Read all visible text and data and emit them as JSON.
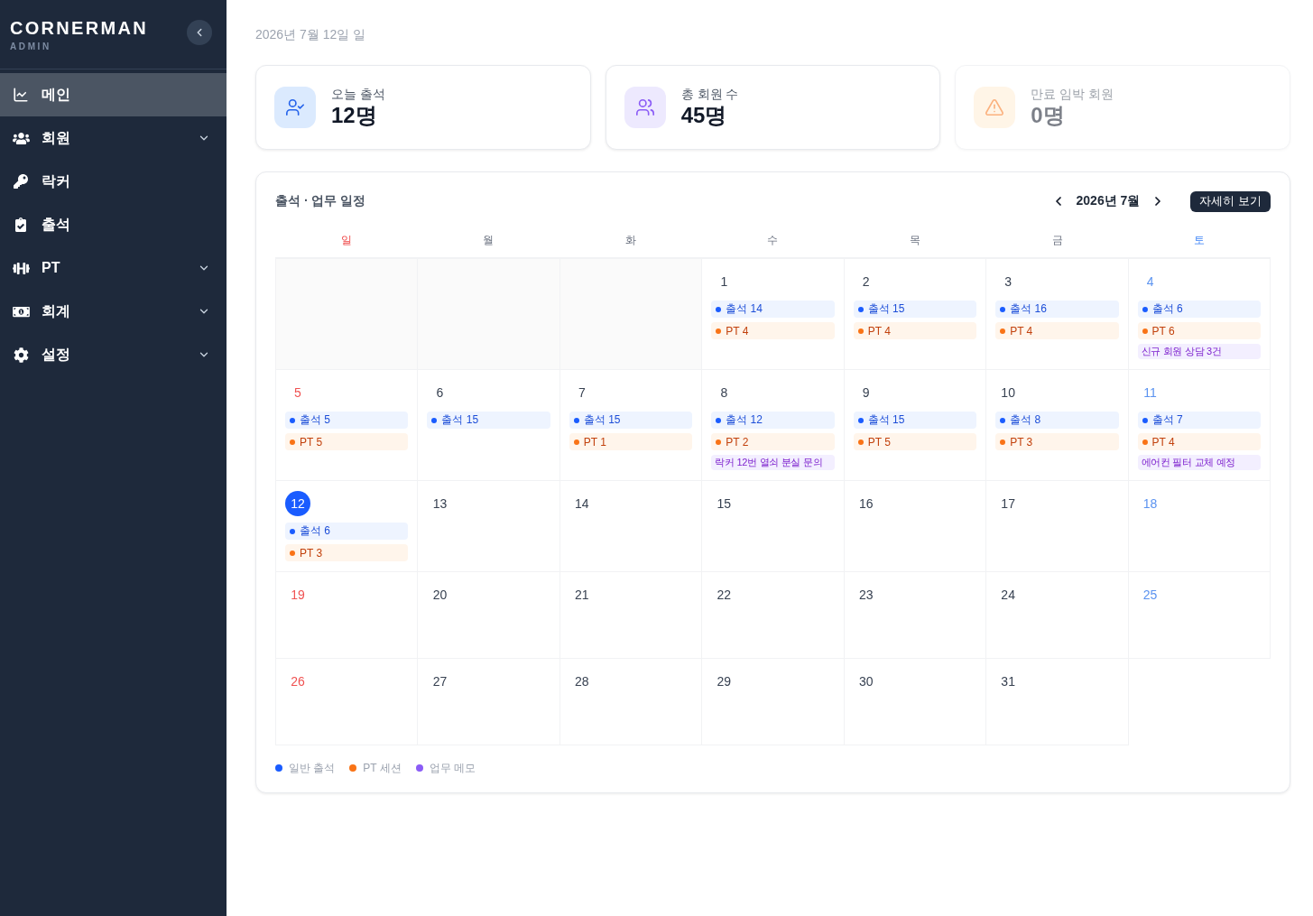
{
  "sidebar": {
    "logo": {
      "title": "CORNERMAN",
      "subtitle": "ADMIN"
    },
    "items": [
      {
        "label": "메인",
        "kind": "link",
        "selected": true
      },
      {
        "label": "회원",
        "kind": "group",
        "selected": false
      },
      {
        "label": "락커",
        "kind": "link",
        "selected": false
      },
      {
        "label": "출석",
        "kind": "link",
        "selected": false
      },
      {
        "label": "PT",
        "kind": "group",
        "selected": false
      },
      {
        "label": "회계",
        "kind": "group",
        "selected": false
      },
      {
        "label": "설정",
        "kind": "group",
        "selected": false
      }
    ]
  },
  "main": {
    "date": "2026년 7월 12일 일",
    "stats": [
      {
        "label": "오늘 출석",
        "value": "12명",
        "muted": false
      },
      {
        "label": "총 회원 수",
        "value": "45명",
        "muted": false
      },
      {
        "label": "만료 임박 회원",
        "value": "0명",
        "muted": true
      }
    ],
    "calendar": {
      "title": "출석 · 업무 일정",
      "month": "2026년 7월",
      "detail_button": "자세히 보기",
      "weekdays": [
        {
          "label": "일",
          "kind": "sunday"
        },
        {
          "label": "월",
          "kind": "weekday"
        },
        {
          "label": "화",
          "kind": "weekday"
        },
        {
          "label": "수",
          "kind": "weekday"
        },
        {
          "label": "목",
          "kind": "weekday"
        },
        {
          "label": "금",
          "kind": "weekday"
        },
        {
          "label": "토",
          "kind": "saturday"
        }
      ],
      "weeks": [
        {
          "days": [
            {
              "kind": "empty"
            },
            {
              "kind": "empty"
            },
            {
              "kind": "empty"
            },
            {
              "kind": "day",
              "date": "1",
              "today": false,
              "events": [
                {
                  "kind": "attendance",
                  "label": "출석 14"
                },
                {
                  "kind": "pt",
                  "label": "PT 4"
                }
              ]
            },
            {
              "kind": "day",
              "date": "2",
              "today": false,
              "events": [
                {
                  "kind": "attendance",
                  "label": "출석 15"
                },
                {
                  "kind": "pt",
                  "label": "PT 4"
                }
              ]
            },
            {
              "kind": "day",
              "date": "3",
              "today": false,
              "events": [
                {
                  "kind": "attendance",
                  "label": "출석 16"
                },
                {
                  "kind": "pt",
                  "label": "PT 4"
                }
              ]
            },
            {
              "kind": "day",
              "date": "4",
              "today": false,
              "events": [
                {
                  "kind": "attendance",
                  "label": "출석 6"
                },
                {
                  "kind": "pt",
                  "label": "PT 6"
                },
                {
                  "kind": "memo",
                  "label": "신규 회원 상담 3건"
                }
              ]
            }
          ]
        },
        {
          "days": [
            {
              "kind": "day",
              "date": "5",
              "today": false,
              "events": [
                {
                  "kind": "attendance",
                  "label": "출석 5"
                },
                {
                  "kind": "pt",
                  "label": "PT 5"
                }
              ]
            },
            {
              "kind": "day",
              "date": "6",
              "today": false,
              "events": [
                {
                  "kind": "attendance",
                  "label": "출석 15"
                }
              ]
            },
            {
              "kind": "day",
              "date": "7",
              "today": false,
              "events": [
                {
                  "kind": "attendance",
                  "label": "출석 15"
                },
                {
                  "kind": "pt",
                  "label": "PT 1"
                }
              ]
            },
            {
              "kind": "day",
              "date": "8",
              "today": false,
              "events": [
                {
                  "kind": "attendance",
                  "label": "출석 12"
                },
                {
                  "kind": "pt",
                  "label": "PT 2"
                },
                {
                  "kind": "memo",
                  "label": "락커 12번 열쇠 분실 문의"
                }
              ]
            },
            {
              "kind": "day",
              "date": "9",
              "today": false,
              "events": [
                {
                  "kind": "attendance",
                  "label": "출석 15"
                },
                {
                  "kind": "pt",
                  "label": "PT 5"
                }
              ]
            },
            {
              "kind": "day",
              "date": "10",
              "today": false,
              "events": [
                {
                  "kind": "attendance",
                  "label": "출석 8"
                },
                {
                  "kind": "pt",
                  "label": "PT 3"
                }
              ]
            },
            {
              "kind": "day",
              "date": "11",
              "today": false,
              "events": [
                {
                  "kind": "attendance",
                  "label": "출석 7"
                },
                {
                  "kind": "pt",
                  "label": "PT 4"
                },
                {
                  "kind": "memo",
                  "label": "에어컨 필터 교체 예정"
                }
              ]
            }
          ]
        },
        {
          "days": [
            {
              "kind": "day",
              "date": "12",
              "today": true,
              "events": [
                {
                  "kind": "attendance",
                  "label": "출석 6"
                },
                {
                  "kind": "pt",
                  "label": "PT 3"
                }
              ]
            },
            {
              "kind": "day",
              "date": "13",
              "today": false
            },
            {
              "kind": "day",
              "date": "14",
              "today": false
            },
            {
              "kind": "day",
              "date": "15",
              "today": false
            },
            {
              "kind": "day",
              "date": "16",
              "today": false
            },
            {
              "kind": "day",
              "date": "17",
              "today": false
            },
            {
              "kind": "day",
              "date": "18",
              "today": false
            }
          ]
        },
        {
          "days": [
            {
              "kind": "day",
              "date": "19",
              "today": false
            },
            {
              "kind": "day",
              "date": "20",
              "today": false
            },
            {
              "kind": "day",
              "date": "21",
              "today": false
            },
            {
              "kind": "day",
              "date": "22",
              "today": false
            },
            {
              "kind": "day",
              "date": "23",
              "today": false
            },
            {
              "kind": "day",
              "date": "24",
              "today": false
            },
            {
              "kind": "day",
              "date": "25",
              "today": false
            }
          ]
        },
        {
          "days": [
            {
              "kind": "day",
              "date": "26",
              "today": false
            },
            {
              "kind": "day",
              "date": "27",
              "today": false
            },
            {
              "kind": "day",
              "date": "28",
              "today": false
            },
            {
              "kind": "day",
              "date": "29",
              "today": false
            },
            {
              "kind": "day",
              "date": "30",
              "today": false
            },
            {
              "kind": "day",
              "date": "31",
              "today": false
            }
          ]
        }
      ],
      "legend": [
        {
          "label": "일반 출석",
          "color": "#1a5cff"
        },
        {
          "label": "PT 세션",
          "color": "#f97316"
        },
        {
          "label": "업무 메모",
          "color": "#8b5cf6"
        }
      ]
    }
  }
}
